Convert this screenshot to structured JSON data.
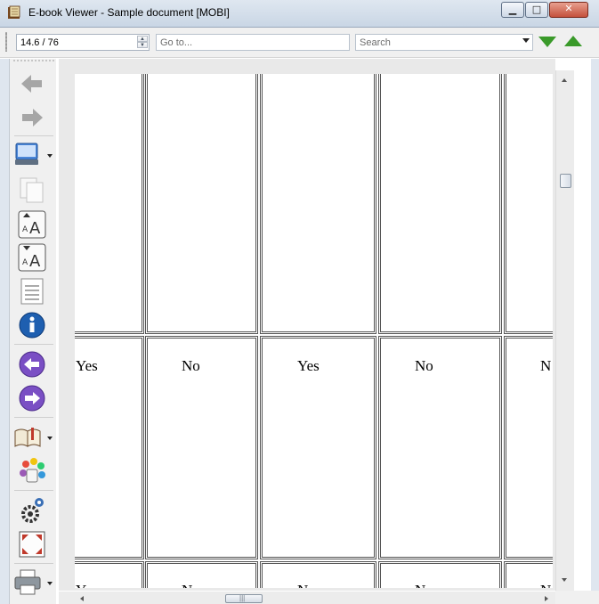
{
  "window": {
    "title": "E-book Viewer - Sample document [MOBI]",
    "icons": {
      "app": "ebook-viewer-icon",
      "minimize": "minimize-icon",
      "maximize": "maximize-icon",
      "close": "close-icon"
    },
    "minimize_glyph": "▁",
    "maximize_glyph": "□",
    "close_glyph": "✕"
  },
  "toolbar": {
    "position_value": "14.6 / 76",
    "goto_placeholder": "Go to...",
    "search_placeholder": "Search",
    "find_next_icon": "find-next-triangle-icon",
    "find_previous_icon": "find-previous-triangle-icon",
    "colors": {
      "find_arrows": "#3a9a2a"
    }
  },
  "sidebar": {
    "buttons": [
      {
        "id": "back",
        "icon": "back-arrow-icon"
      },
      {
        "id": "forward",
        "icon": "forward-arrow-icon"
      },
      {
        "id": "mode",
        "icon": "reference-mode-icon",
        "has_dropdown": true
      },
      {
        "id": "copy",
        "icon": "copy-icon"
      },
      {
        "id": "font-larger",
        "icon": "font-size-larger-icon"
      },
      {
        "id": "font-smaller",
        "icon": "font-size-smaller-icon"
      },
      {
        "id": "toc",
        "icon": "table-of-contents-icon"
      },
      {
        "id": "metadata",
        "icon": "info-icon"
      },
      {
        "id": "previous-page",
        "icon": "previous-page-icon"
      },
      {
        "id": "next-page",
        "icon": "next-page-icon"
      },
      {
        "id": "bookmarks",
        "icon": "bookmarks-icon",
        "has_dropdown": true
      },
      {
        "id": "themes",
        "icon": "theme-icon"
      },
      {
        "id": "preferences",
        "icon": "preferences-gear-icon"
      },
      {
        "id": "fullscreen",
        "icon": "fullscreen-icon"
      },
      {
        "id": "print",
        "icon": "print-icon",
        "has_dropdown": true
      }
    ],
    "colors": {
      "nav_arrows": "#7a4fc4",
      "info": "#1e5fb0",
      "disabled": "#a6a6a6"
    }
  },
  "document": {
    "table_rows": [
      [
        "",
        "",
        "",
        "",
        ""
      ],
      [
        "Yes",
        "No",
        "Yes",
        "No",
        "N"
      ],
      [
        "Y",
        "N",
        "N",
        "N",
        "N"
      ]
    ]
  }
}
